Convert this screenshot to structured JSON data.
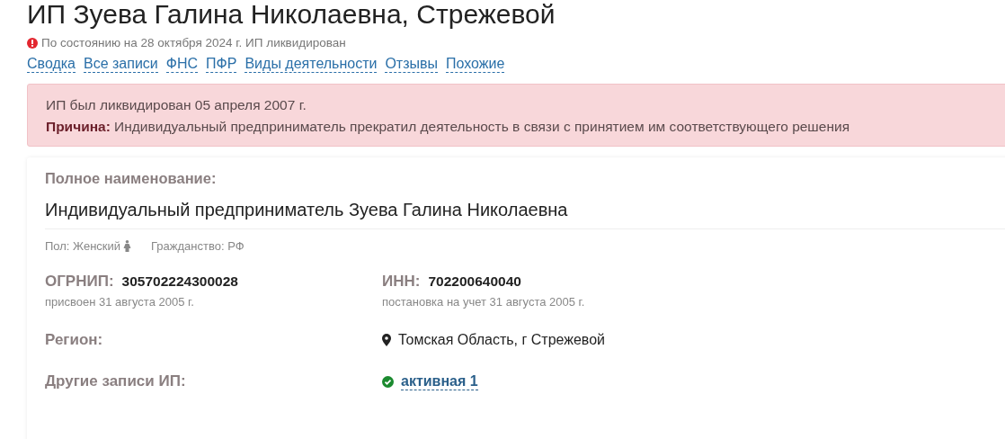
{
  "title": "ИП Зуева Галина Николаевна, Стрежевой",
  "status": {
    "kind": "liquidated",
    "text": "По состоянию на 28 октября 2024 г. ИП ликвидирован"
  },
  "tabs": [
    "Сводка",
    "Все записи",
    "ФНС",
    "ПФР",
    "Виды деятельности",
    "Отзывы",
    "Похожие"
  ],
  "alert": {
    "line": "ИП был ликвидирован 05 апреля 2007 г.",
    "reason": "**Причина:** Индивидуальный предприниматель прекратил деятельность в связи с принятием им соответствующего решения"
  },
  "card": {
    "full_name_label": "Полное наименование:",
    "full_name": "Индивидуальный предприниматель Зуева Галина Николаевна",
    "gender": "Пол: Женский",
    "citizenship": "Гражданство: РФ",
    "codes": [
      {
        "label": "ОГРНИП:",
        "value": "305702224300028",
        "note": "присвоен 31 августа 2005 г."
      },
      {
        "label": "ИНН:",
        "value": "702200640040",
        "note": "постановка на учет 31 августа 2005 г."
      }
    ],
    "region": {
      "label": "Регион:",
      "value": "Томская Область, г Стрежевой"
    },
    "other": {
      "label": "Другие записи ИП:",
      "link": "активная 1",
      "kind": "active"
    }
  }
}
